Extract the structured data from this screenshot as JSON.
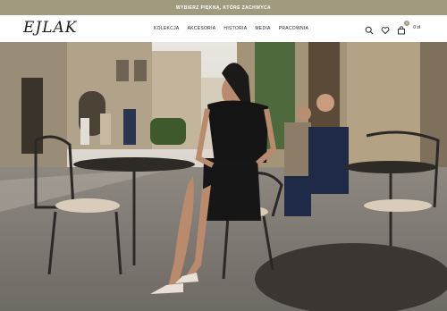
{
  "promo": {
    "text": "WYBIERZ PIĘKNĄ, KTÓRE ZACHWYCA"
  },
  "header": {
    "logo": "EJLAK",
    "nav": [
      {
        "label": "KOLEKCJA"
      },
      {
        "label": "AKCESORIA"
      },
      {
        "label": "HISTORIA"
      },
      {
        "label": "MEDIA"
      },
      {
        "label": "PRACOWNIA"
      }
    ],
    "icons": [
      "search-icon",
      "heart-icon",
      "cart-icon"
    ],
    "cart": {
      "count": "0",
      "total": "0 zł"
    }
  },
  "hero": {
    "image": "woman-in-black-dress-seated-at-street-cafe"
  },
  "colors": {
    "promo_bg": "#a09a7e",
    "accent": "#a09a7e"
  }
}
